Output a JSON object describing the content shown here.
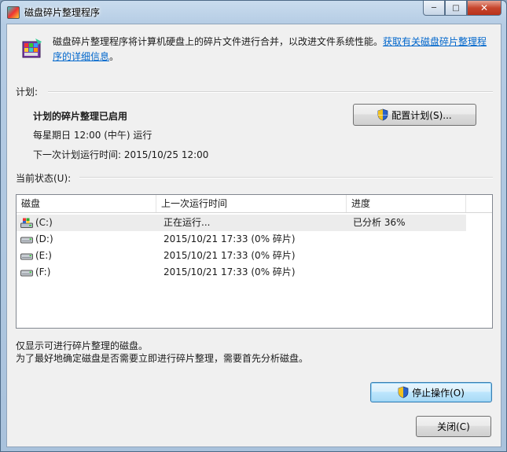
{
  "window": {
    "title": "磁盘碎片整理程序"
  },
  "caption": {
    "minimize": "─",
    "maximize": "□",
    "close": "✕"
  },
  "description": {
    "text": "磁盘碎片整理程序将计算机硬盘上的碎片文件进行合并，以改进文件系统性能。",
    "link": "获取有关磁盘碎片整理程序的详细信息",
    "suffix": "。"
  },
  "schedule": {
    "label": "计划:",
    "status": "计划的碎片整理已启用",
    "frequency": "每星期日  12:00 (中午) 运行",
    "next_run": "下一次计划运行时间: 2015/10/25 12:00",
    "configure_button": "配置计划(S)..."
  },
  "current_status": {
    "label": "当前状态(U):",
    "columns": [
      "磁盘",
      "上一次运行时间",
      "进度"
    ],
    "rows": [
      {
        "disk": "(C:)",
        "last_run": "正在运行...",
        "progress": "已分析 36%",
        "icon": "system-drive-icon"
      },
      {
        "disk": "(D:)",
        "last_run": "2015/10/21 17:33 (0% 碎片)",
        "progress": "",
        "icon": "hard-drive-icon"
      },
      {
        "disk": "(E:)",
        "last_run": "2015/10/21 17:33 (0% 碎片)",
        "progress": "",
        "icon": "hard-drive-icon"
      },
      {
        "disk": "(F:)",
        "last_run": "2015/10/21 17:33 (0% 碎片)",
        "progress": "",
        "icon": "hard-drive-icon"
      }
    ]
  },
  "notes": {
    "line1": "仅显示可进行碎片整理的磁盘。",
    "line2": "为了最好地确定磁盘是否需要立即进行碎片整理，需要首先分析磁盘。"
  },
  "actions": {
    "stop_button": "停止操作(O)",
    "close_button": "关闭(C)"
  }
}
